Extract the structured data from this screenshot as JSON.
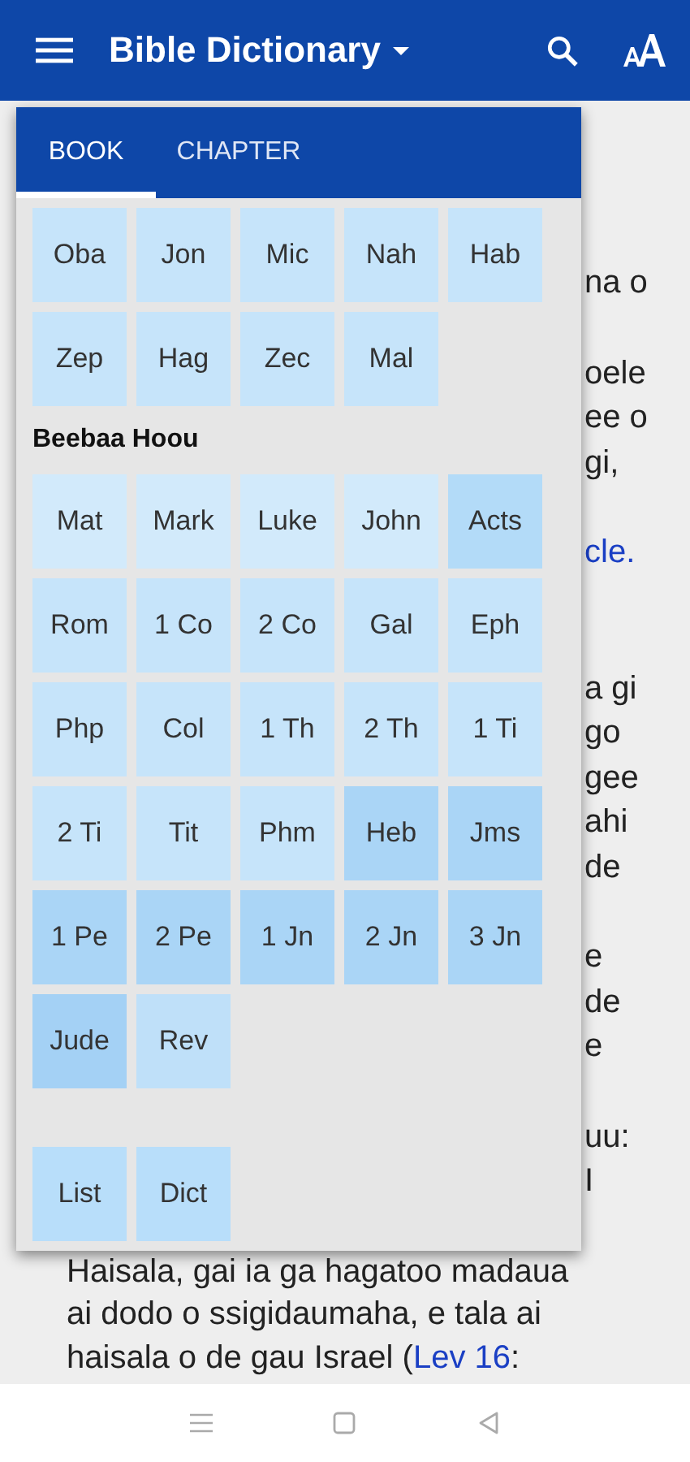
{
  "app_bar": {
    "title": "Bible Dictionary"
  },
  "article": {
    "paragraphs": [
      {
        "lines": [
          {
            "kind": "text",
            "text": "na o"
          }
        ]
      },
      {
        "lines": [
          {
            "kind": "text",
            "text": "oele"
          },
          {
            "kind": "text",
            "text": "ee o"
          },
          {
            "kind": "text",
            "text": "gi,"
          }
        ]
      },
      {
        "lines": [
          {
            "kind": "link",
            "text": "cle."
          }
        ]
      },
      {
        "lines": [
          {
            "kind": "text",
            "text": "a gi"
          },
          {
            "kind": "text",
            "text": "go"
          },
          {
            "kind": "text",
            "text": "gee"
          },
          {
            "kind": "text",
            "text": "ahi"
          },
          {
            "kind": "text",
            "text": "de"
          }
        ]
      },
      {
        "lines": [
          {
            "kind": "text",
            "text": "e"
          },
          {
            "kind": "text",
            "text": "de"
          },
          {
            "kind": "text",
            "text": "e"
          }
        ]
      },
      {
        "lines": [
          {
            "kind": "text",
            "text": "uu:"
          },
          {
            "kind": "text",
            "text": "I"
          }
        ]
      }
    ],
    "full_lines": [
      {
        "text": "Haisala, gai ia ga hagatoo madaua"
      },
      {
        "text": "ai dodo o ssigidaumaha, e tala ai"
      },
      {
        "text": "haisala o de gau Israel (",
        "link": "Lev 16",
        "after": ":"
      }
    ]
  },
  "book_picker": {
    "tabs": [
      {
        "label": "BOOK",
        "selected": true
      },
      {
        "label": "CHAPTER",
        "selected": false
      }
    ],
    "sections": [
      {
        "books": [
          {
            "label": "Oba",
            "color": "#c6e4fa"
          },
          {
            "label": "Jon",
            "color": "#c6e4fa"
          },
          {
            "label": "Mic",
            "color": "#c6e4fa"
          },
          {
            "label": "Nah",
            "color": "#c6e4fa"
          },
          {
            "label": "Hab",
            "color": "#c6e4fa"
          },
          {
            "label": "Zep",
            "color": "#c6e4fa"
          },
          {
            "label": "Hag",
            "color": "#c6e4fa"
          },
          {
            "label": "Zec",
            "color": "#c6e4fa"
          },
          {
            "label": "Mal",
            "color": "#c6e4fa"
          }
        ]
      },
      {
        "heading": "Beebaa Hoou",
        "books": [
          {
            "label": "Mat",
            "color": "#d2eafb"
          },
          {
            "label": "Mark",
            "color": "#d2eafb"
          },
          {
            "label": "Luke",
            "color": "#d2eafb"
          },
          {
            "label": "John",
            "color": "#d2eafb"
          },
          {
            "label": "Acts",
            "color": "#b3dbf8"
          },
          {
            "label": "Rom",
            "color": "#c6e4fa"
          },
          {
            "label": "1 Co",
            "color": "#c6e4fa"
          },
          {
            "label": "2 Co",
            "color": "#c6e4fa"
          },
          {
            "label": "Gal",
            "color": "#c6e4fa"
          },
          {
            "label": "Eph",
            "color": "#c6e4fa"
          },
          {
            "label": "Php",
            "color": "#c6e4fa"
          },
          {
            "label": "Col",
            "color": "#c6e4fa"
          },
          {
            "label": "1 Th",
            "color": "#c6e4fa"
          },
          {
            "label": "2 Th",
            "color": "#c6e4fa"
          },
          {
            "label": "1 Ti",
            "color": "#c6e4fa"
          },
          {
            "label": "2 Ti",
            "color": "#c6e4fa"
          },
          {
            "label": "Tit",
            "color": "#c6e4fa"
          },
          {
            "label": "Phm",
            "color": "#c6e4fa"
          },
          {
            "label": "Heb",
            "color": "#aad5f6"
          },
          {
            "label": "Jms",
            "color": "#aad5f6"
          },
          {
            "label": "1 Pe",
            "color": "#aad5f6"
          },
          {
            "label": "2 Pe",
            "color": "#aad5f6"
          },
          {
            "label": "1 Jn",
            "color": "#aad5f6"
          },
          {
            "label": "2 Jn",
            "color": "#aad5f6"
          },
          {
            "label": "3 Jn",
            "color": "#aad5f6"
          },
          {
            "label": "Jude",
            "color": "#a4d1f5"
          },
          {
            "label": "Rev",
            "color": "#bfe0f9"
          }
        ]
      }
    ],
    "extras": [
      {
        "label": "List"
      },
      {
        "label": "Dict"
      }
    ]
  }
}
